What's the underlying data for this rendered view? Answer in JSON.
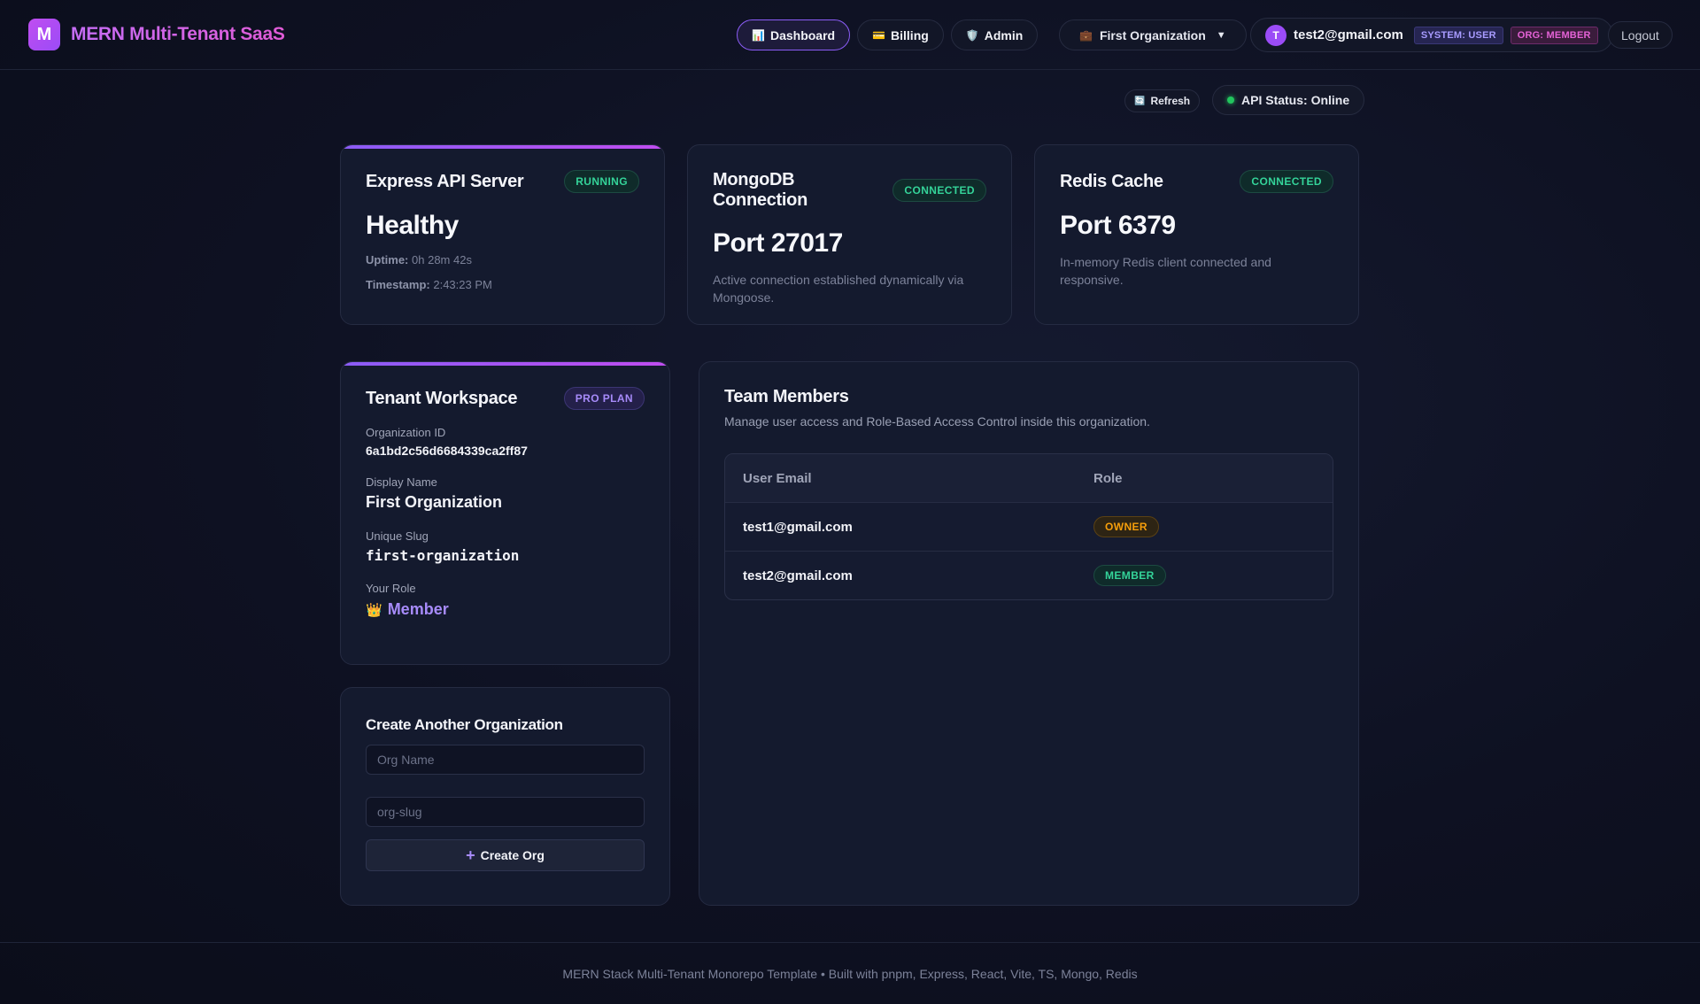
{
  "header": {
    "logo_letter": "M",
    "title": "MERN Multi-Tenant SaaS",
    "nav": [
      {
        "label": "Dashboard",
        "icon": "📊"
      },
      {
        "label": "Billing",
        "icon": "💳"
      },
      {
        "label": "Admin",
        "icon": "🛡️"
      }
    ],
    "org_selector": {
      "icon": "💼",
      "label": "First Organization",
      "caret": "▼"
    },
    "user": {
      "avatar_letter": "T",
      "email": "test2@gmail.com",
      "system_role": "SYSTEM: USER",
      "org_role": "ORG: MEMBER"
    },
    "logout_label": "Logout"
  },
  "status_bar": {
    "refresh_icon": "🔄",
    "refresh_label": "Refresh",
    "api_status_label": "API Status: Online"
  },
  "services": [
    {
      "title": "Express API Server",
      "badge": "RUNNING",
      "value": "Healthy",
      "uptime_label": "Uptime:",
      "uptime": "0h 28m 42s",
      "timestamp_label": "Timestamp:",
      "timestamp": "2:43:23 PM"
    },
    {
      "title": "MongoDB Connection",
      "badge": "CONNECTED",
      "value": "Port 27017",
      "description": "Active connection established dynamically via Mongoose."
    },
    {
      "title": "Redis Cache",
      "badge": "CONNECTED",
      "value": "Port 6379",
      "description": "In-memory Redis client connected and responsive."
    }
  ],
  "workspace": {
    "title": "Tenant Workspace",
    "badge": "PRO PLAN",
    "org_id_label": "Organization ID",
    "org_id": "6a1bd2c56d6684339ca2ff87",
    "display_name_label": "Display Name",
    "display_name": "First Organization",
    "slug_label": "Unique Slug",
    "slug": "first-organization",
    "role_label": "Your Role",
    "role_icon": "👑",
    "role": "Member"
  },
  "create_org": {
    "title": "Create Another Organization",
    "name_placeholder": "Org Name",
    "slug_placeholder": "org-slug",
    "button_label": "Create Org"
  },
  "team": {
    "title": "Team Members",
    "subtitle": "Manage user access and Role-Based Access Control inside this organization.",
    "columns": [
      "User Email",
      "Role"
    ],
    "rows": [
      {
        "email": "test1@gmail.com",
        "role": "OWNER"
      },
      {
        "email": "test2@gmail.com",
        "role": "MEMBER"
      }
    ]
  },
  "footer": "MERN Stack Multi-Tenant Monorepo Template • Built with pnpm, Express, React, Vite, TS, Mongo, Redis",
  "colors": {
    "accent": "#8b5cf6",
    "brand": "#c04df0",
    "success": "#34d399",
    "warning": "#f59e0b"
  }
}
